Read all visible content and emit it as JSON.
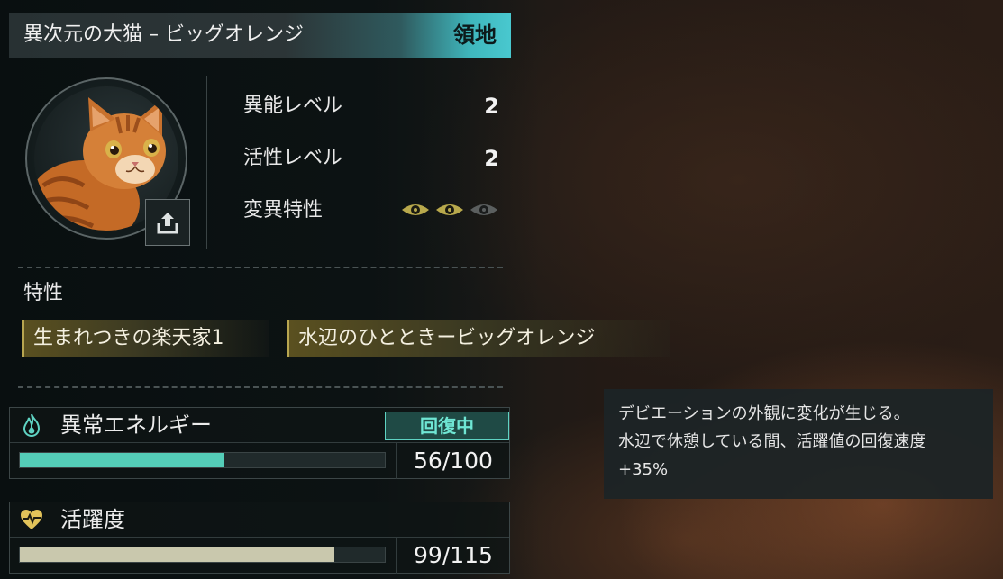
{
  "header": {
    "title": "異次元の大猫 – ビッグオレンジ",
    "tag": "領地"
  },
  "stats": [
    {
      "label": "異能レベル",
      "value": "2"
    },
    {
      "label": "活性レベル",
      "value": "2"
    },
    {
      "label": "変異特性",
      "eyes_active": 2,
      "eyes_total": 3
    }
  ],
  "traits": {
    "title": "特性",
    "items": [
      "生まれつきの楽天家1",
      "水辺のひとときービッグオレンジ"
    ]
  },
  "energy": {
    "name": "異常エネルギー",
    "status": "回復中",
    "value": "56/100",
    "current": 56,
    "max": 100,
    "color": "#54cdb8",
    "icon": "flame-icon"
  },
  "vitality": {
    "name": "活躍度",
    "value": "99/115",
    "current": 99,
    "max": 115,
    "color": "#c9c8ad",
    "icon": "heartbeat-icon"
  },
  "tooltip": {
    "line1": "デビエーションの外観に変化が生じる。",
    "line2": "水辺で休憩している間、活躍値の回復速度",
    "line3": "+35%"
  },
  "colors": {
    "accent_teal": "#49c8cf",
    "trait_gold": "#b8a650",
    "eye_active": "#b8a94c",
    "eye_inactive": "#5b5f5f"
  }
}
